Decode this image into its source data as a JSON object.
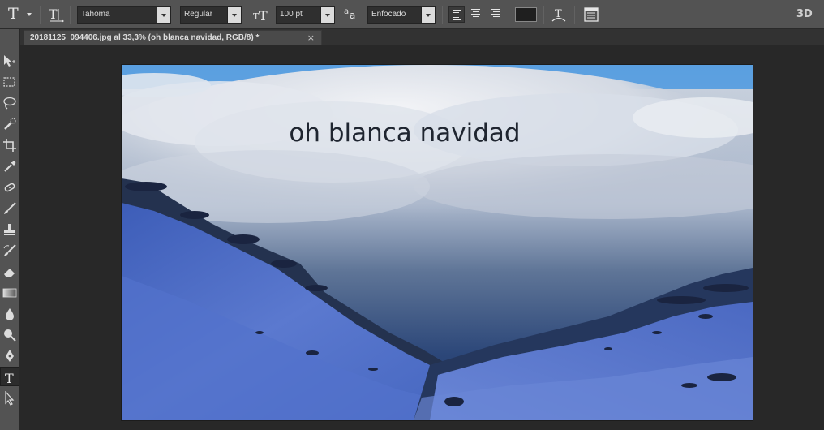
{
  "options_bar": {
    "tool_icon": "type-tool-icon",
    "font_family": "Tahoma",
    "font_style": "Regular",
    "font_size": "100 pt",
    "antialias_label": "a",
    "antialias_label_small": "a",
    "antialias_mode": "Enfocado",
    "text_color": "#1f1f1f",
    "three_d_label": "3D"
  },
  "document": {
    "tab_title": "20181125_094406.jpg al 33,3% (oh blanca navidad, RGB/8) *",
    "close_glyph": "×"
  },
  "canvas": {
    "text_layer": "oh blanca navidad"
  },
  "toolbar": {
    "tools": [
      "move-tool-icon",
      "marquee-tool-icon",
      "lasso-tool-icon",
      "quick-select-tool-icon",
      "crop-tool-icon",
      "eyedropper-tool-icon",
      "healing-tool-icon",
      "brush-tool-icon",
      "stamp-tool-icon",
      "history-brush-tool-icon",
      "eraser-tool-icon",
      "gradient-tool-icon",
      "blur-tool-icon",
      "dodge-tool-icon",
      "pen-tool-icon",
      "type-tool-icon",
      "path-select-tool-icon"
    ],
    "active": "type-tool-icon"
  },
  "colors": {
    "ui_panel": "#535353",
    "ui_dark": "#282828",
    "text_layer_color": "#1f2530"
  }
}
